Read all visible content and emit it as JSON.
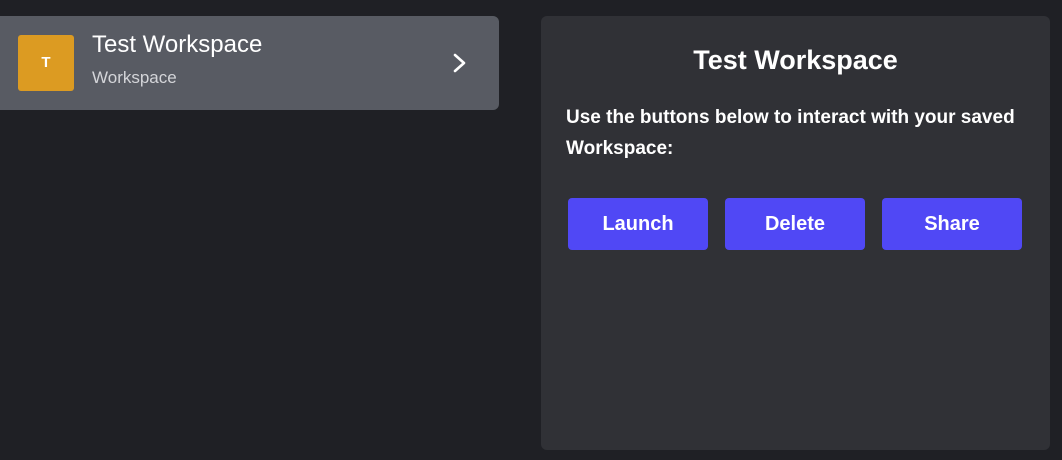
{
  "workspace_list": {
    "items": [
      {
        "initial": "T",
        "title": "Test Workspace",
        "subtitle": "Workspace",
        "icon": "chevron-right-icon"
      }
    ]
  },
  "detail_panel": {
    "title": "Test Workspace",
    "description": "Use the buttons below to interact with your saved Workspace:",
    "buttons": {
      "launch": "Launch",
      "delete": "Delete",
      "share": "Share"
    }
  },
  "colors": {
    "background": "#1f2025",
    "item_selected_bg": "#585b63",
    "avatar_bg": "#dc9b22",
    "panel_bg": "#303136",
    "button_accent": "#5048f5"
  }
}
